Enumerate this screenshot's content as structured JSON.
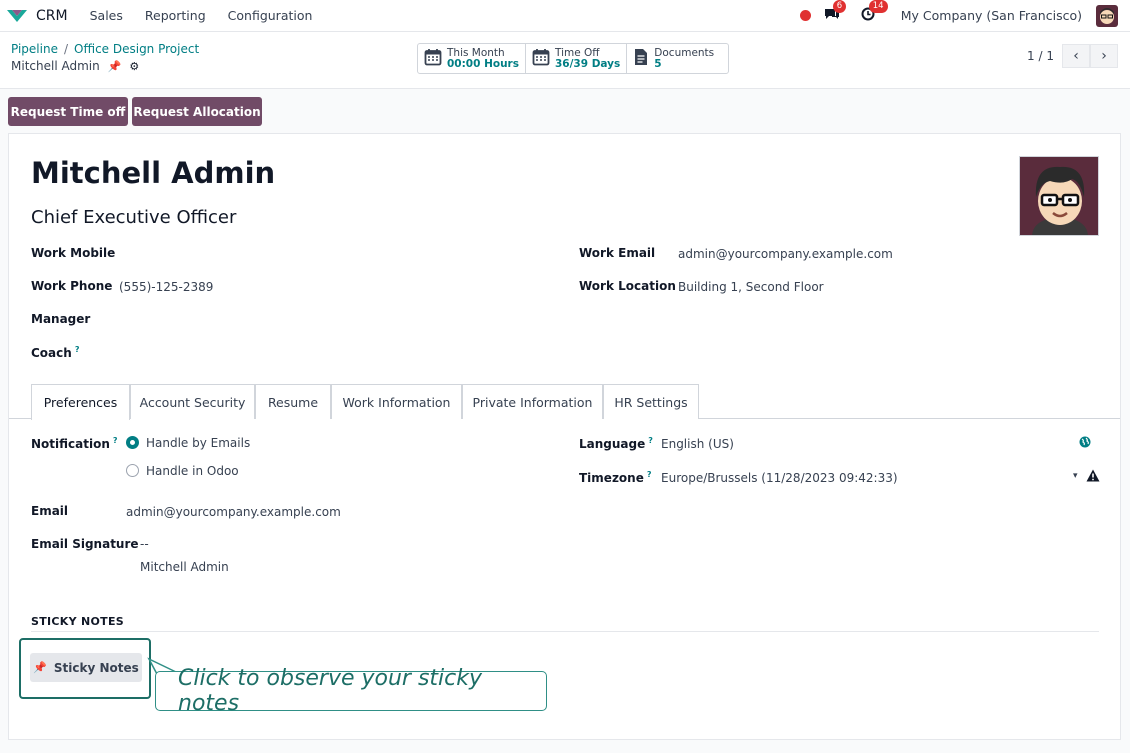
{
  "topnav": {
    "app_name": "CRM",
    "menu": [
      "Sales",
      "Reporting",
      "Configuration"
    ],
    "messages_count": "6",
    "activities_count": "14",
    "company": "My Company (San Francisco)"
  },
  "breadcrumb": {
    "items": [
      "Pipeline",
      "Office Design Project"
    ],
    "separator": "/",
    "record_title": "Mitchell Admin"
  },
  "smart_buttons": [
    {
      "label": "This Month",
      "value": "00:00 Hours",
      "icon": "calendar-icon"
    },
    {
      "label": "Time Off",
      "value": "36/39 Days",
      "icon": "calendar-icon"
    },
    {
      "label": "Documents",
      "value": "5",
      "icon": "document-icon"
    }
  ],
  "pager": {
    "text": "1 / 1"
  },
  "actions": {
    "request_time_off": "Request Time off",
    "request_allocation": "Request Allocation"
  },
  "employee": {
    "name": "Mitchell Admin",
    "job_title": "Chief Executive Officer",
    "work_mobile_label": "Work Mobile",
    "work_mobile": "",
    "work_phone_label": "Work Phone",
    "work_phone": "(555)-125-2389",
    "manager_label": "Manager",
    "coach_label": "Coach",
    "work_email_label": "Work Email",
    "work_email": "admin@yourcompany.example.com",
    "work_location_label": "Work Location",
    "work_location": "Building 1, Second Floor"
  },
  "tabs": [
    "Preferences",
    "Account Security",
    "Resume",
    "Work Information",
    "Private Information",
    "HR Settings"
  ],
  "preferences": {
    "notification_label": "Notification",
    "notification_options": [
      "Handle by Emails",
      "Handle in Odoo"
    ],
    "notification_selected": "Handle by Emails",
    "language_label": "Language",
    "language": "English (US)",
    "timezone_label": "Timezone",
    "timezone": "Europe/Brussels (11/28/2023 09:42:33)",
    "email_label": "Email",
    "email": "admin@yourcompany.example.com",
    "signature_label": "Email Signature",
    "signature_dashes": "--",
    "signature_name": "Mitchell Admin"
  },
  "sticky_section": {
    "title": "STICKY NOTES",
    "button": "Sticky Notes"
  },
  "tooltip": {
    "text": "Click to observe your sticky notes"
  },
  "colors": {
    "primary": "#714b67",
    "accent": "#017e84",
    "danger": "#e03131",
    "tooltip": "#1d6e66"
  }
}
